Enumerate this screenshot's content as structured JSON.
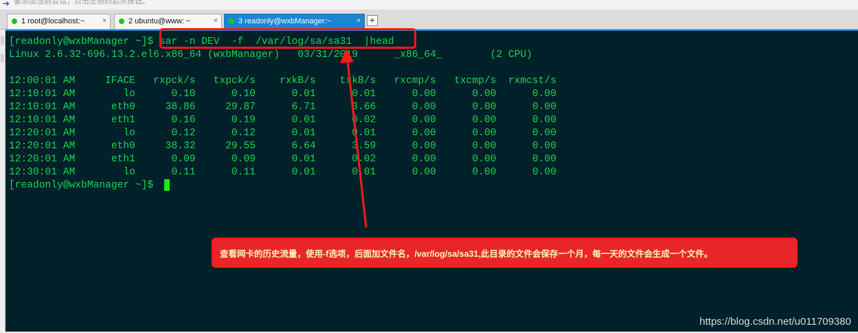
{
  "hint_bar": {
    "arrow": "➔",
    "text": "要添加当前会话，点击左侧的箭头按钮。"
  },
  "tabs": [
    {
      "label": "1 root@localhost:~",
      "close": "×",
      "active": false
    },
    {
      "label": "2 ubuntu@www: ~",
      "close": "×",
      "active": false
    },
    {
      "label": "3 readonly@wxbManager:~",
      "close": "×",
      "active": true
    }
  ],
  "add_tab": "+",
  "terminal": {
    "prompt1": "[readonly@wxbManager ~]$ sar -n DEV  -f  /var/log/sa/sa31  |head",
    "sysinfo": "Linux 2.6.32-696.13.2.el6.x86_64 (wxbManager)   03/31/2019      _x86_64_        (2 CPU)",
    "header": "12:00:01 AM     IFACE   rxpck/s   txpck/s    rxkB/s    txkB/s   rxcmp/s   txcmp/s  rxmcst/s",
    "rows": [
      "12:10:01 AM        lo      0.10      0.10      0.01      0.01      0.00      0.00      0.00",
      "12:10:01 AM      eth0     38.86     29.87      6.71      3.66      0.00      0.00      0.00",
      "12:10:01 AM      eth1      0.16      0.19      0.01      0.02      0.00      0.00      0.00",
      "12:20:01 AM        lo      0.12      0.12      0.01      0.01      0.00      0.00      0.00",
      "12:20:01 AM      eth0     38.32     29.55      6.64      3.59      0.00      0.00      0.00",
      "12:20:01 AM      eth1      0.09      0.09      0.01      0.02      0.00      0.00      0.00",
      "12:30:01 AM        lo      0.11      0.11      0.01      0.01      0.00      0.00      0.00"
    ],
    "prompt2": "[readonly@wxbManager ~]$ "
  },
  "annotation": {
    "text": "查看网卡的历史流量，使用-f选项，后面加文件名，/var/log/sa/sa31,此目录的文件会保存一个月，每一天的文件会生成一个文件。",
    "color": "#ff1a1a"
  },
  "watermark": "https://blog.csdn.net/u011709380",
  "colors": {
    "terminal_bg": "#00202a",
    "terminal_fg": "#19d64f",
    "tab_active": "#1e84d4"
  }
}
